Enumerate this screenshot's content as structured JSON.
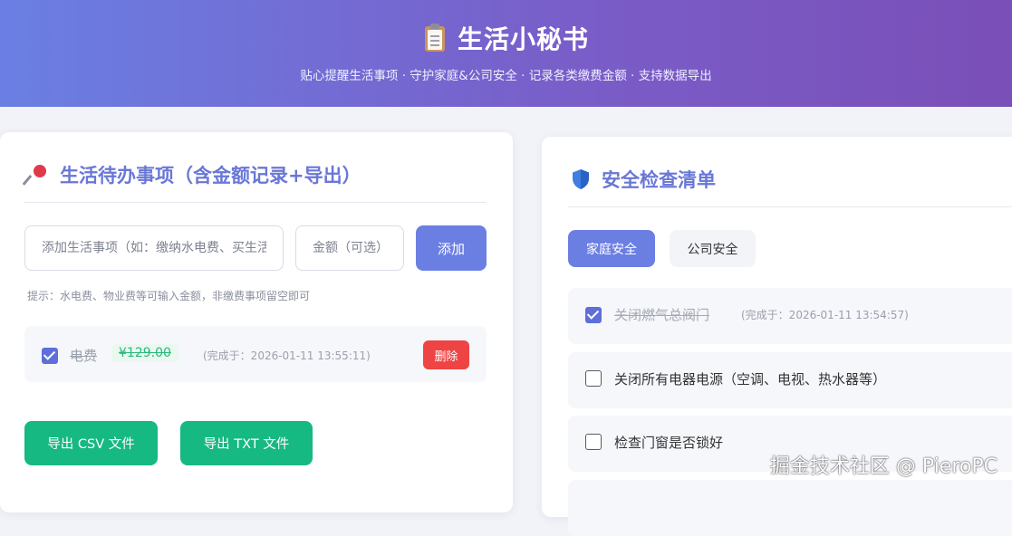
{
  "header": {
    "title": "生活小秘书",
    "subtitle": "贴心提醒生活事项 · 守护家庭&公司安全 · 记录各类缴费金额 · 支持数据导出",
    "icon": "clipboard-icon"
  },
  "todo": {
    "title": "生活待办事项（含金额记录+导出）",
    "icon": "pushpin-icon",
    "item_input_placeholder": "添加生活事项（如：缴纳水电费、买生活用品）",
    "amount_input_placeholder": "金额（可选）",
    "add_label": "添加",
    "hint": "提示：水电费、物业费等可输入金额，非缴费事项留空即可",
    "items": [
      {
        "name": "电费",
        "amount": "¥129.00",
        "completed_at": "(完成于：2026-01-11 13:55:11)",
        "checked": true,
        "delete_label": "删除"
      }
    ],
    "export_csv_label": "导出 CSV 文件",
    "export_txt_label": "导出 TXT 文件"
  },
  "safety": {
    "title": "安全检查清单",
    "icon": "shield-icon",
    "tabs": [
      {
        "label": "家庭安全",
        "active": true
      },
      {
        "label": "公司安全",
        "active": false
      }
    ],
    "items": [
      {
        "label": "关闭燃气总阀门",
        "checked": true,
        "completed_at": "(完成于：2026-01-11 13:54:57)"
      },
      {
        "label": "关闭所有电器电源（空调、电视、热水器等）",
        "checked": false
      },
      {
        "label": "检查门窗是否锁好",
        "checked": false
      }
    ]
  },
  "watermark": "掘金技术社区 @ PieroPC",
  "colors": {
    "accent": "#6b7fe3",
    "success": "#16b981",
    "danger": "#ef4444",
    "header_start": "#6a7fe3",
    "header_end": "#7a4fb7"
  }
}
